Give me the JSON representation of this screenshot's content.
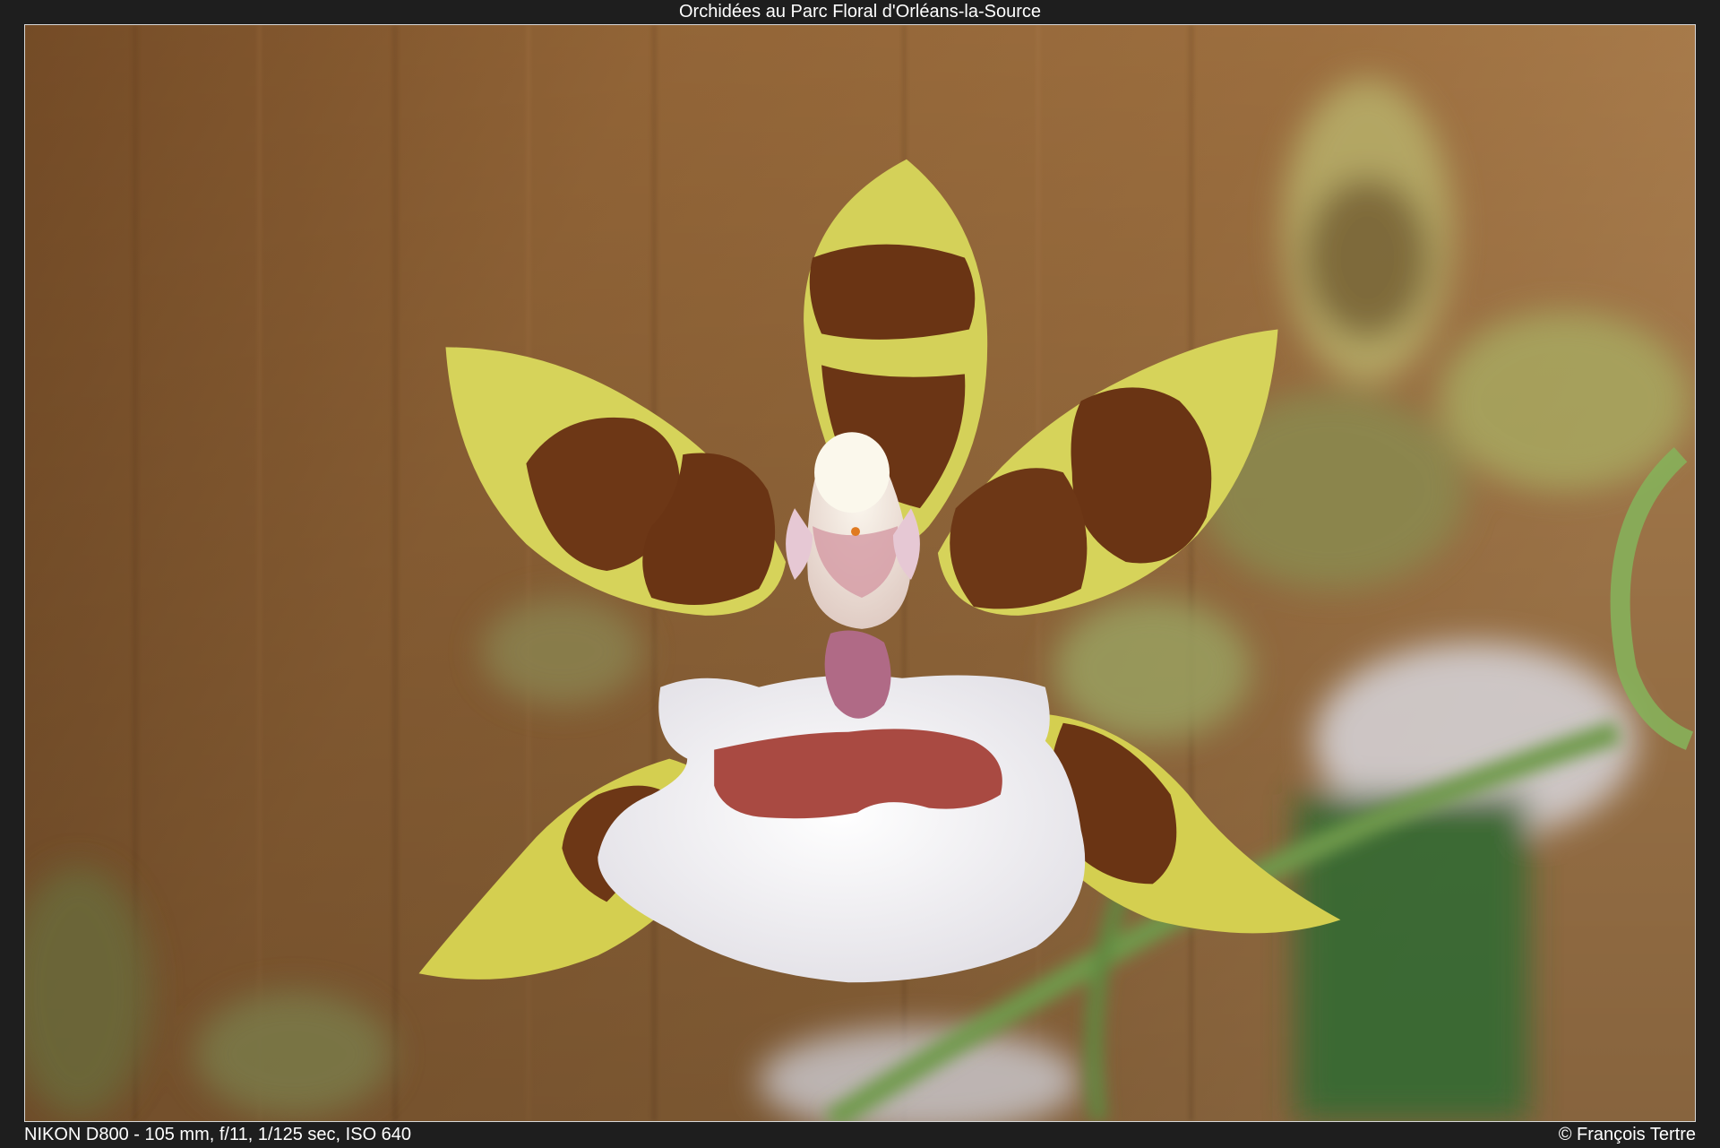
{
  "header": {
    "title": "Orchidées au Parc Floral d'Orléans-la-Source"
  },
  "footer": {
    "exif": "NIKON D800 - 105 mm, f/11, 1/125 sec, ISO 640",
    "copyright": "© François Tertre"
  },
  "photo": {
    "subject": "orchid-flower",
    "colors": {
      "background_wood": "#9a6a3a",
      "petal_yellow": "#d8d35a",
      "blotch_brown": "#6a3414",
      "lip_white": "#f4f2f4",
      "lip_patch": "#a94a42",
      "stem_green": "#7aa85a"
    }
  }
}
